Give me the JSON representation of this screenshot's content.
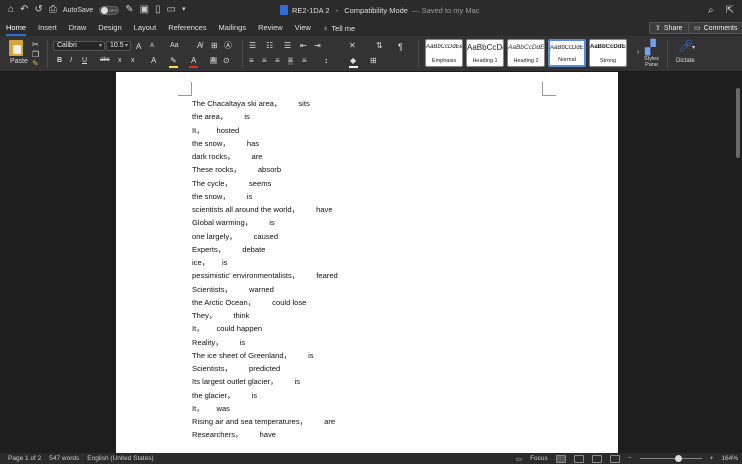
{
  "titlebar": {
    "autosave_label": "AutoSave",
    "autosave_state": "OFF",
    "doc_name": "RE2-1DA 2",
    "separator": " - ",
    "mode": "Compatibility Mode",
    "save_status": "— Saved to my Mac",
    "icons": [
      "home-icon",
      "undo-icon",
      "redo-icon",
      "print-icon",
      "save-icon",
      "new-doc-icon",
      "open-icon",
      "overflow-icon",
      "search-icon",
      "share-icon"
    ]
  },
  "tabs": [
    {
      "label": "Home",
      "active": true
    },
    {
      "label": "Insert"
    },
    {
      "label": "Draw"
    },
    {
      "label": "Design"
    },
    {
      "label": "Layout"
    },
    {
      "label": "References"
    },
    {
      "label": "Mailings"
    },
    {
      "label": "Review"
    },
    {
      "label": "View"
    }
  ],
  "tell_me": "Tell me",
  "share_label": "Share",
  "comments_label": "Comments",
  "ribbon": {
    "paste_label": "Paste",
    "font_name": "Calibri",
    "font_size": "10.5",
    "grow_font": "A",
    "shrink_font": "A",
    "change_case": "Aa",
    "bold": "B",
    "italic": "I",
    "underline": "U",
    "strikethrough": "abc",
    "subscript": "x",
    "superscript": "x",
    "font_color_letter": "A",
    "highlight_letter": "A",
    "pilcrow": "¶",
    "styles_pane_label": "Styles\nPane",
    "dictate_label": "Dictate",
    "accent_red": "#e02b2b",
    "accent_yellow": "#f4e04d",
    "accent_blue": "#2f6cd6",
    "styles": [
      {
        "sample": "AaBbCcDdEe",
        "name": "Emphasis",
        "variant": "emph"
      },
      {
        "sample": "AaBbCcDc",
        "name": "Heading 1",
        "variant": "heading1"
      },
      {
        "sample": "AaBbCcDdE",
        "name": "Heading 2",
        "variant": "heading2"
      },
      {
        "sample": "AaBbCcDdEe",
        "name": "Normal",
        "variant": "normal",
        "selected": true
      },
      {
        "sample": "AaBbCcDdEe",
        "name": "Strong",
        "variant": "strong"
      }
    ]
  },
  "document": {
    "lines": [
      "The Chacaltaya ski area，        sits",
      "the area，        is",
      "It，      hosted",
      "the snow，        has",
      "dark rocks，        are",
      "These rocks，        absorb",
      "The cycle，        seems",
      "the snow，        is",
      "scientists all around the world，        have",
      "Global warming，        is",
      "one largely，        caused",
      "Experts，        debate",
      "ice，      is",
      "pessimistic' environmentalists，        feared",
      "Scientists，        warned",
      "the Arctic Ocean，        could lose",
      "They，        think",
      "It，      could happen",
      "Reality，        is",
      "The ice sheet of Greenland，        is",
      "Scientists，        predicted",
      "Its largest outlet glacier，        is",
      "the glacier，        is",
      "It，      was",
      "Rising air and sea temperatures，        are",
      "Researchers，        have"
    ]
  },
  "status": {
    "page": "Page 1 of 2",
    "words": "547 words",
    "language": "English (United States)",
    "focus": "Focus",
    "zoom": "164%",
    "zoom_minus": "−",
    "zoom_plus": "+",
    "zoom_level": 0.62
  }
}
